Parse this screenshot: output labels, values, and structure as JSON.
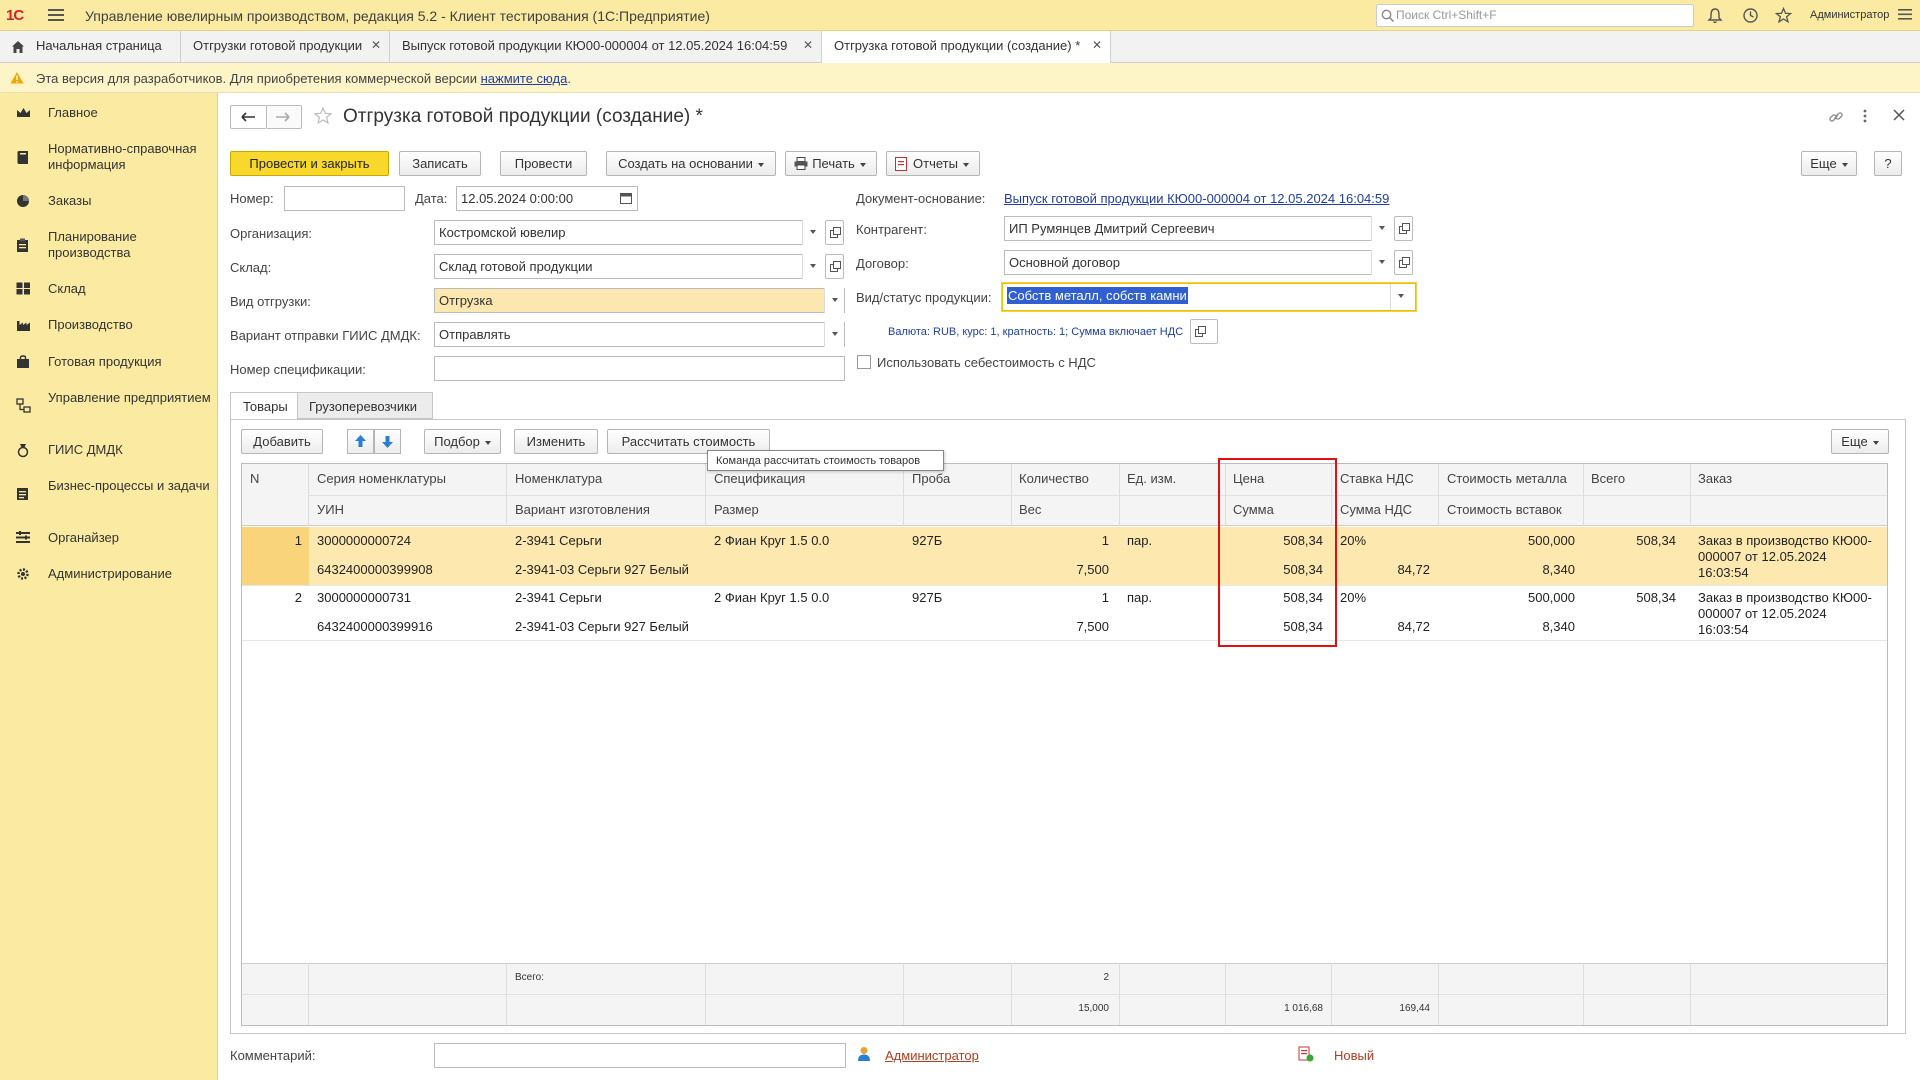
{
  "titlebar": {
    "logo": "1С",
    "title": "Управление ювелирным производством, редакция 5.2 - Клиент тестирования (1С:Предприятие)",
    "search_placeholder": "Поиск Ctrl+Shift+F",
    "user": "Администратор"
  },
  "tabs": [
    {
      "label": "Начальная страница"
    },
    {
      "label": "Отгрузки готовой продукции"
    },
    {
      "label": "Выпуск готовой продукции КЮ00-000004 от 12.05.2024 16:04:59"
    },
    {
      "label": "Отгрузка готовой продукции (создание) *",
      "active": true
    }
  ],
  "warning": {
    "text": "Эта версия для разработчиков. Для приобретения коммерческой версии",
    "link": "нажмите сюда",
    "tail": "."
  },
  "sidebar": [
    {
      "label": "Главное",
      "icon": "crown-icon"
    },
    {
      "label": "Нормативно-справочная информация",
      "icon": "book-icon"
    },
    {
      "label": "Заказы",
      "icon": "pie-icon"
    },
    {
      "label": "Планирование производства",
      "icon": "planning-icon"
    },
    {
      "label": "Склад",
      "icon": "warehouse-icon"
    },
    {
      "label": "Производство",
      "icon": "factory-icon"
    },
    {
      "label": "Готовая продукция",
      "icon": "bag-icon"
    },
    {
      "label": "Управление предприятием",
      "icon": "enterprise-icon"
    },
    {
      "label": "ГИИС ДМДК",
      "icon": "giis-icon"
    },
    {
      "label": "Бизнес-процессы и задачи",
      "icon": "process-icon"
    },
    {
      "label": "Органайзер",
      "icon": "organizer-icon"
    },
    {
      "label": "Администрирование",
      "icon": "gear-icon"
    }
  ],
  "form": {
    "title": "Отгрузка готовой продукции (создание) *",
    "buttons": {
      "post_close": "Провести и закрыть",
      "save": "Записать",
      "post": "Провести",
      "create_based": "Создать на основании",
      "print": "Печать",
      "reports": "Отчеты",
      "more": "Еще",
      "help": "?"
    },
    "fields": {
      "number_label": "Номер:",
      "number_value": "",
      "date_label": "Дата:",
      "date_value": "12.05.2024  0:00:00",
      "org_label": "Организация:",
      "org_value": "Костромской ювелир",
      "warehouse_label": "Склад:",
      "warehouse_value": "Склад готовой продукции",
      "shipment_type_label": "Вид отгрузки:",
      "shipment_type_value": "Отгрузка",
      "giis_label": "Вариант отправки ГИИС ДМДК:",
      "giis_value": "Отправлять",
      "spec_label": "Номер спецификации:",
      "spec_value": "",
      "basis_label": "Документ-основание:",
      "basis_link": "Выпуск готовой продукции КЮ00-000004 от 12.05.2024 16:04:59",
      "counterparty_label": "Контрагент:",
      "counterparty_value": "ИП Румянцев Дмитрий Сергеевич",
      "contract_label": "Договор:",
      "contract_value": "Основной договор",
      "product_status_label": "Вид/статус продукции:",
      "product_status_value": "Собств металл, собств камни",
      "currency_link": "Валюта: RUB, курс: 1, кратность: 1; Сумма включает НДС",
      "use_cost_vat": "Использовать себестоимость с НДС",
      "use_cost_vat_checked": false
    },
    "doc_tabs": [
      "Товары",
      "Грузоперевозчики"
    ],
    "table_toolbar": {
      "add": "Добавить",
      "selection": "Подбор",
      "change": "Изменить",
      "calc": "Рассчитать стоимость",
      "more": "Еще",
      "tooltip": "Команда рассчитать стоимость товаров"
    },
    "table": {
      "headers_top": [
        "N",
        "Серия номенклатуры",
        "Номенклатура",
        "Спецификация",
        "Проба",
        "Количество",
        "Ед. изм.",
        "Цена",
        "Ставка НДС",
        "Стоимость металла",
        "Всего",
        "Заказ"
      ],
      "headers_bottom": [
        "УИН",
        "Вариант изготовления",
        "Размер",
        "Вес",
        "Сумма",
        "Сумма НДС",
        "Стоимость вставок"
      ],
      "rows": [
        {
          "n": "1",
          "series": "3000000000724",
          "uin": "6432400000399908",
          "nom": "2-3941 Серьги",
          "variant": "2-3941-03 Серьги 927 Белый",
          "spec": "2 Фиан Круг 1.5 0.0",
          "size": "",
          "probe": "927Б",
          "qty": "1",
          "weight": "7,500",
          "unit": "пар.",
          "price": "508,34",
          "sum": "508,34",
          "vat_rate": "20%",
          "vat_sum": "84,72",
          "metal_cost": "500,000",
          "inserts_cost": "8,340",
          "total": "508,34",
          "order": [
            "Заказ в производство КЮ00-",
            "000007 от 12.05.2024",
            "16:03:54"
          ]
        },
        {
          "n": "2",
          "series": "3000000000731",
          "uin": "6432400000399916",
          "nom": "2-3941 Серьги",
          "variant": "2-3941-03 Серьги 927 Белый",
          "spec": "2 Фиан Круг 1.5 0.0",
          "size": "",
          "probe": "927Б",
          "qty": "1",
          "weight": "7,500",
          "unit": "пар.",
          "price": "508,34",
          "sum": "508,34",
          "vat_rate": "20%",
          "vat_sum": "84,72",
          "metal_cost": "500,000",
          "inserts_cost": "8,340",
          "total": "508,34",
          "order": [
            "Заказ в производство КЮ00-",
            "000007 от 12.05.2024",
            "16:03:54"
          ]
        }
      ],
      "footer": {
        "label": "Всего:",
        "qty": "2",
        "weight": "15,000",
        "sum": "1 016,68",
        "vat_sum": "169,44"
      }
    },
    "comment_label": "Комментарий:",
    "comment_value": "",
    "author": "Администратор",
    "status": "Новый"
  },
  "colors": {
    "accent": "#fbeba2",
    "primary_button": "#f7d82b",
    "selected_row": "#fde9b0",
    "highlight_box": "#e01010",
    "link": "#1f3da8"
  }
}
